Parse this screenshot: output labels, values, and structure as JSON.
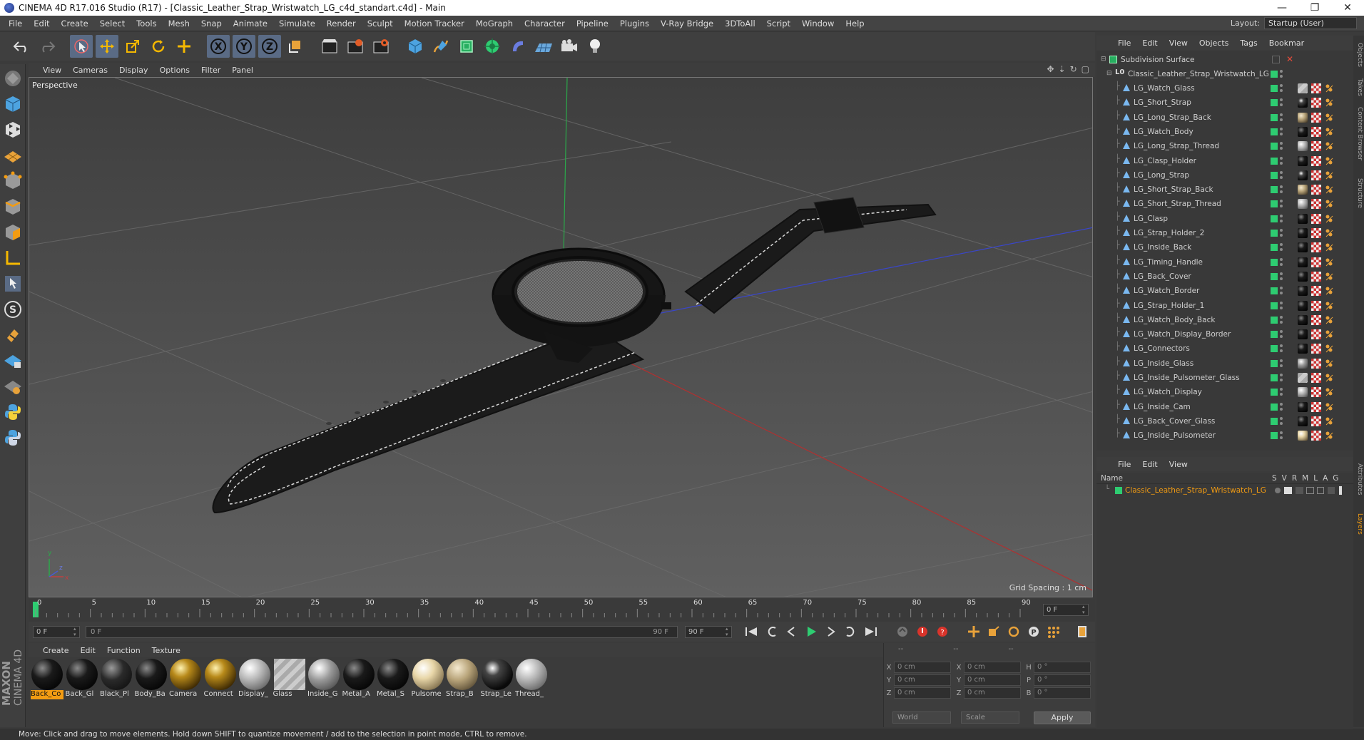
{
  "window": {
    "title": "CINEMA 4D R17.016 Studio (R17) - [Classic_Leather_Strap_Wristwatch_LG_c4d_standart.c4d] - Main",
    "controls": [
      "—",
      "❐",
      "✕"
    ]
  },
  "menubar": {
    "items": [
      "File",
      "Edit",
      "Create",
      "Select",
      "Tools",
      "Mesh",
      "Snap",
      "Animate",
      "Simulate",
      "Render",
      "Sculpt",
      "Motion Tracker",
      "MoGraph",
      "Character",
      "Pipeline",
      "Plugins",
      "V-Ray Bridge",
      "3DToAll",
      "Script",
      "Window",
      "Help"
    ],
    "layout_label": "Layout:",
    "layout_value": "Startup (User)"
  },
  "viewport": {
    "menu": [
      "View",
      "Cameras",
      "Display",
      "Options",
      "Filter",
      "Panel"
    ],
    "label": "Perspective",
    "grid_spacing": "Grid Spacing : 1 cm",
    "axis_y": "y",
    "axis_z": "z",
    "axis_x": "x"
  },
  "timeline": {
    "ticks": [
      "0",
      "5",
      "10",
      "15",
      "20",
      "25",
      "30",
      "35",
      "40",
      "45",
      "50",
      "55",
      "60",
      "65",
      "70",
      "75",
      "80",
      "85",
      "90"
    ],
    "current_frame": "0 F",
    "start_field": "0 F",
    "slider_start": "0 F",
    "slider_end": "90 F",
    "end_field": "90 F"
  },
  "materials": {
    "menu": [
      "Create",
      "Edit",
      "Function",
      "Texture"
    ],
    "items": [
      {
        "label": "Back_Co",
        "style": "black",
        "selected": true
      },
      {
        "label": "Back_Gl",
        "style": "black"
      },
      {
        "label": "Black_Pl",
        "style": "darkgray"
      },
      {
        "label": "Body_Ba",
        "style": "black"
      },
      {
        "label": "Camera",
        "style": "gold"
      },
      {
        "label": "Connect",
        "style": "gold"
      },
      {
        "label": "Display_",
        "style": "silver"
      },
      {
        "label": "Glass",
        "style": "glass"
      },
      {
        "label": "Inside_G",
        "style": "glassball"
      },
      {
        "label": "Metal_A",
        "style": "black"
      },
      {
        "label": "Metal_S",
        "style": "black"
      },
      {
        "label": "Pulsome",
        "style": "cream"
      },
      {
        "label": "Strap_B",
        "style": "tan"
      },
      {
        "label": "Strap_Le",
        "style": "darkglass"
      },
      {
        "label": "Thread_",
        "style": "silver"
      }
    ]
  },
  "coords": {
    "headers": [
      "--",
      "--",
      "--"
    ],
    "rows": [
      {
        "a1": "X",
        "v1": "0 cm",
        "a2": "X",
        "v2": "0 cm",
        "a3": "H",
        "v3": "0 °"
      },
      {
        "a1": "Y",
        "v1": "0 cm",
        "a2": "Y",
        "v2": "0 cm",
        "a3": "P",
        "v3": "0 °"
      },
      {
        "a1": "Z",
        "v1": "0 cm",
        "a2": "Z",
        "v2": "0 cm",
        "a3": "B",
        "v3": "0 °"
      }
    ],
    "world": "World",
    "scale": "Scale",
    "apply": "Apply"
  },
  "status": "Move: Click and drag to move elements. Hold down SHIFT to quantize movement / add to the selection in point mode, CTRL to remove.",
  "object_manager": {
    "menu": [
      "File",
      "Edit",
      "View",
      "Objects",
      "Tags",
      "Bookmar"
    ],
    "root": "Subdivision Surface",
    "group": "Classic_Leather_Strap_Wristwatch_LG",
    "objects": [
      {
        "name": "LG_Watch_Glass",
        "mat": "glass"
      },
      {
        "name": "LG_Short_Strap",
        "mat": "darkglass"
      },
      {
        "name": "LG_Long_Strap_Back",
        "mat": "tan"
      },
      {
        "name": "LG_Watch_Body",
        "mat": "black"
      },
      {
        "name": "LG_Long_Strap_Thread",
        "mat": "silver"
      },
      {
        "name": "LG_Clasp_Holder",
        "mat": "black"
      },
      {
        "name": "LG_Long_Strap",
        "mat": "darkglass"
      },
      {
        "name": "LG_Short_Strap_Back",
        "mat": "tan"
      },
      {
        "name": "LG_Short_Strap_Thread",
        "mat": "silver"
      },
      {
        "name": "LG_Clasp",
        "mat": "black"
      },
      {
        "name": "LG_Strap_Holder_2",
        "mat": "black"
      },
      {
        "name": "LG_Inside_Back",
        "mat": "black"
      },
      {
        "name": "LG_Timing_Handle",
        "mat": "black"
      },
      {
        "name": "LG_Back_Cover",
        "mat": "black"
      },
      {
        "name": "LG_Watch_Border",
        "mat": "black"
      },
      {
        "name": "LG_Strap_Holder_1",
        "mat": "black"
      },
      {
        "name": "LG_Watch_Body_Back",
        "mat": "black"
      },
      {
        "name": "LG_Watch_Display_Border",
        "mat": "black"
      },
      {
        "name": "LG_Connectors",
        "mat": "black"
      },
      {
        "name": "LG_Inside_Glass",
        "mat": "glassball"
      },
      {
        "name": "LG_Inside_Pulsometer_Glass",
        "mat": "glass"
      },
      {
        "name": "LG_Watch_Display",
        "mat": "silver"
      },
      {
        "name": "LG_Inside_Cam",
        "mat": "black"
      },
      {
        "name": "LG_Back_Cover_Glass",
        "mat": "black"
      },
      {
        "name": "LG_Inside_Pulsometer",
        "mat": "cream"
      }
    ]
  },
  "layer_manager": {
    "menu": [
      "File",
      "Edit",
      "View"
    ],
    "header_name": "Name",
    "columns": [
      "S",
      "V",
      "R",
      "M",
      "L",
      "A",
      "G"
    ],
    "layer": "Classic_Leather_Strap_Wristwatch_LG"
  },
  "right_tabs": [
    "Objects",
    "Takes",
    "Content Browser",
    "Structure",
    "Attributes",
    "Layers"
  ],
  "maxon": {
    "line1": "MAXON",
    "line2": "CINEMA 4D"
  },
  "colors": {
    "accent": "#f39c12",
    "active_tool": "#5a6b85",
    "tag_green": "#2ecc71"
  }
}
